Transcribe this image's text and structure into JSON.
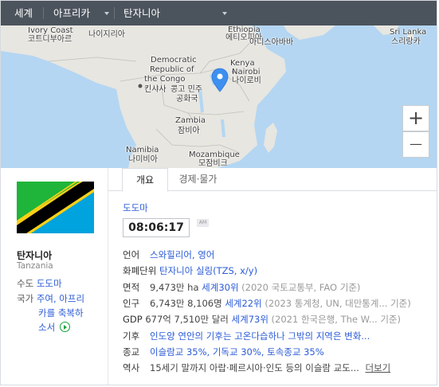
{
  "nav": {
    "world": "세계",
    "region": "아프리카",
    "country": "탄자니아"
  },
  "map": {
    "labels": {
      "ivory_en": "Ivory Coast",
      "ivory_ko": "코트디부아르",
      "nigeria_ko": "나이지리아",
      "ethiopia_en": "Ethiopia",
      "ethiopia_ko": "에티오피아",
      "addis": "아디스아바바",
      "srilanka_en": "Sri Lanka",
      "srilanka_ko": "스리랑카",
      "drc_en_1": "Democratic",
      "drc_en_2": "Republic of",
      "drc_en_3": "the Congo",
      "kinshasa": "킨샤사",
      "drc_ko_1": "콩고 민주",
      "drc_ko_2": "공화국",
      "kenya_en": "Kenya",
      "nairobi_en": "Nairobi",
      "nairobi_ko": "나이로비",
      "zambia_en": "Zambia",
      "zambia_ko": "잠비아",
      "namibia_en": "Namibia",
      "namibia_ko": "나미비아",
      "mozambique_en": "Mozambique",
      "mozambique_ko": "모잠비크"
    },
    "zoom_in": "+",
    "zoom_out": "—",
    "colors": {
      "land": "#e7e6e1",
      "water": "#b4d6f2",
      "marker": "#3d8ff0"
    }
  },
  "country": {
    "name_ko": "탄자니아",
    "name_en": "Tanzania",
    "capital_label": "수도",
    "capital": "도도마",
    "anthem_label": "국가",
    "anthem_1": "주여, 아프리",
    "anthem_2": "카를 축복하",
    "anthem_3": "소서",
    "flag_colors": {
      "green": "#1eb53a",
      "blue": "#00a3dd",
      "yellow": "#fcd116",
      "black": "#000000"
    }
  },
  "tabs": {
    "overview": "개요",
    "economy": "경제·물가"
  },
  "time": {
    "city": "도도마",
    "clock": "08:06:17",
    "ampm": "AM"
  },
  "info": [
    {
      "label": "언어",
      "link": "스와힐리어, 영어",
      "value": "",
      "gray": ""
    },
    {
      "label": "화폐단위",
      "link": "탄자니아 실링(TZS, x/y)",
      "value": "",
      "gray": ""
    },
    {
      "label": "면적",
      "value": "9,473만 ha",
      "link": "세계30위",
      "gray": "(2020 국토교통부, FAO 기준)"
    },
    {
      "label": "인구",
      "value": "6,743만 8,106명",
      "link": "세계22위",
      "gray": "(2023 통계청, UN, 대만통계... 기준)"
    },
    {
      "label": "GDP",
      "value": "677억 7,510만 달러",
      "link": "세계73위",
      "gray": "(2021 한국은행, The W... 기준)"
    },
    {
      "label": "기후",
      "link": "인도양 연안의 기후는 고온다습하나 그밖의 지역은 변화...",
      "value": "",
      "gray": ""
    },
    {
      "label": "종교",
      "link": "이슬람교 35%, 기독교 30%, 토속종교 35%",
      "value": "",
      "gray": ""
    },
    {
      "label": "역사",
      "value": "15세기 말까지 아랍·페르시아·인도 등의 이슬람 교도...",
      "link": "",
      "gray": "",
      "more": "더보기"
    }
  ]
}
